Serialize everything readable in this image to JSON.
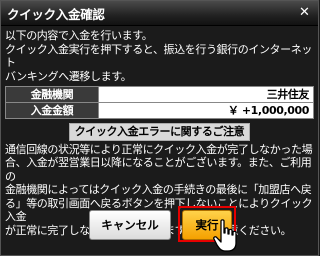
{
  "dialog": {
    "title": "クイック入金確認",
    "close_glyph": "✕"
  },
  "intro": [
    "以下の内容で入金を行います。",
    "クイック入金実行を押下すると、振込を行う銀行のインターネット",
    "バンキングへ遷移します。"
  ],
  "info": [
    {
      "label": "金融機関",
      "value": "三井住友"
    },
    {
      "label": "入金金額",
      "value": "￥ +1,000,000"
    }
  ],
  "warning_label": "クイック入金エラーに関するご注意",
  "notice": [
    "通信回線の状況等により正常にクイック入金が完了しなかった場",
    "合、入金が翌営業日以降になることがございます。また、ご利用の",
    "金融機関によってはクイック入金の手続きの最後に「加盟店へ戻",
    "る」等の取引画面へ戻るボタンを押下しないことによりクイック入金",
    "が正常に完了しない場合がございますのでご注意ください。"
  ],
  "buttons": {
    "cancel": "キャンセル",
    "execute": "実行"
  },
  "colors": {
    "execute_bg": "#f5a100",
    "highlight_frame": "#e60000"
  },
  "icons": {
    "close": "close-icon",
    "cursor": "hand-pointer-icon"
  }
}
